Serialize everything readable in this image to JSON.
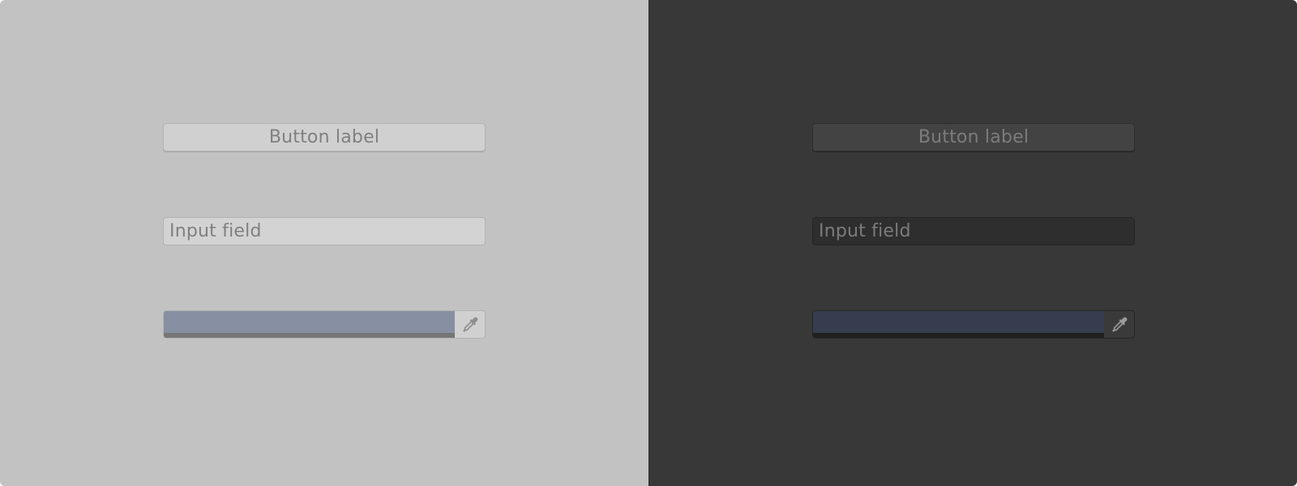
{
  "themes": {
    "light": {
      "button_label": "Button label",
      "input_placeholder": "Input field",
      "color_value": "#8790A3",
      "picker_icon": "eyedropper-icon"
    },
    "dark": {
      "button_label": "Button label",
      "input_placeholder": "Input field",
      "color_value": "#353D4E",
      "picker_icon": "eyedropper-icon"
    }
  }
}
